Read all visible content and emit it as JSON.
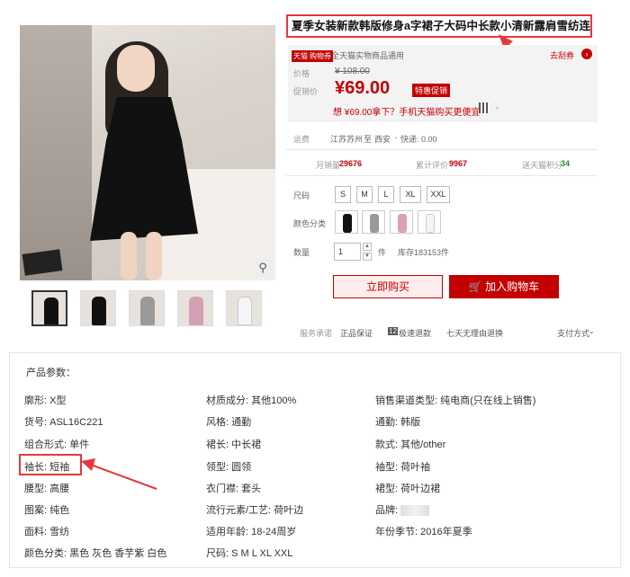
{
  "title": "夏季女装新款韩版修身a字裙子大码中长款小清新露肩雪纺连衣裙夏",
  "price": {
    "tmall_badge": "天猫",
    "coupon_badge": "购物券",
    "coupon_text": "全天猫实物商品通用",
    "get_coupon": "去刮券",
    "price_label": "价格",
    "old_price": "¥ 108.00",
    "promo_label": "促销价",
    "new_price": "¥69.00",
    "sale_tag": "特惠促销",
    "mobile_text": "想 ¥69.00拿下？手机天猫购买更便宜"
  },
  "delivery": {
    "label": "运费",
    "from": "江苏苏州",
    "to_label": "至",
    "to": "西安",
    "fee": "快递: 0.00"
  },
  "stats": {
    "monthly_label": "月销量",
    "monthly": "29676",
    "reviews_label": "累计评价",
    "reviews": "9967",
    "points_label": "送天猫积分",
    "points": "34"
  },
  "size": {
    "label": "尺码",
    "options": [
      "S",
      "M",
      "L",
      "XL",
      "XXL"
    ]
  },
  "color": {
    "label": "颜色分类",
    "swatches": [
      "black-icon",
      "gray-icon",
      "pink-icon",
      "white-icon"
    ]
  },
  "quantity": {
    "label": "数量",
    "value": "1",
    "unit": "件",
    "stock": "库存183153件"
  },
  "buttons": {
    "buy": "立即购买",
    "cart": "加入购物车"
  },
  "service": {
    "label": "服务承诺",
    "item1": "正品保证",
    "item2_badge": "12",
    "item2": "极速退款",
    "item3": "七天无理由退换",
    "pay": "支付方式"
  },
  "params": {
    "header": "产品参数：",
    "items": [
      "廓形: X型",
      "材质成分: 其他100%",
      "销售渠道类型: 纯电商(只在线上销售)",
      "货号: ASL16C221",
      "风格: 通勤",
      "通勤: 韩版",
      "组合形式: 单件",
      "裙长: 中长裙",
      "款式: 其他/other",
      "袖长: 短袖",
      "领型: 圆领",
      "袖型: 荷叶袖",
      "腰型: 高腰",
      "衣门襟: 套头",
      "裙型: 荷叶边裙",
      "图案: 纯色",
      "流行元素/工艺: 荷叶边",
      "品牌:",
      "面料: 雪纺",
      "适用年龄: 18-24周岁",
      "年份季节: 2016年夏季",
      "颜色分类: 黑色 灰色 香芋紫 白色",
      "尺码: S M L XL XXL"
    ]
  }
}
